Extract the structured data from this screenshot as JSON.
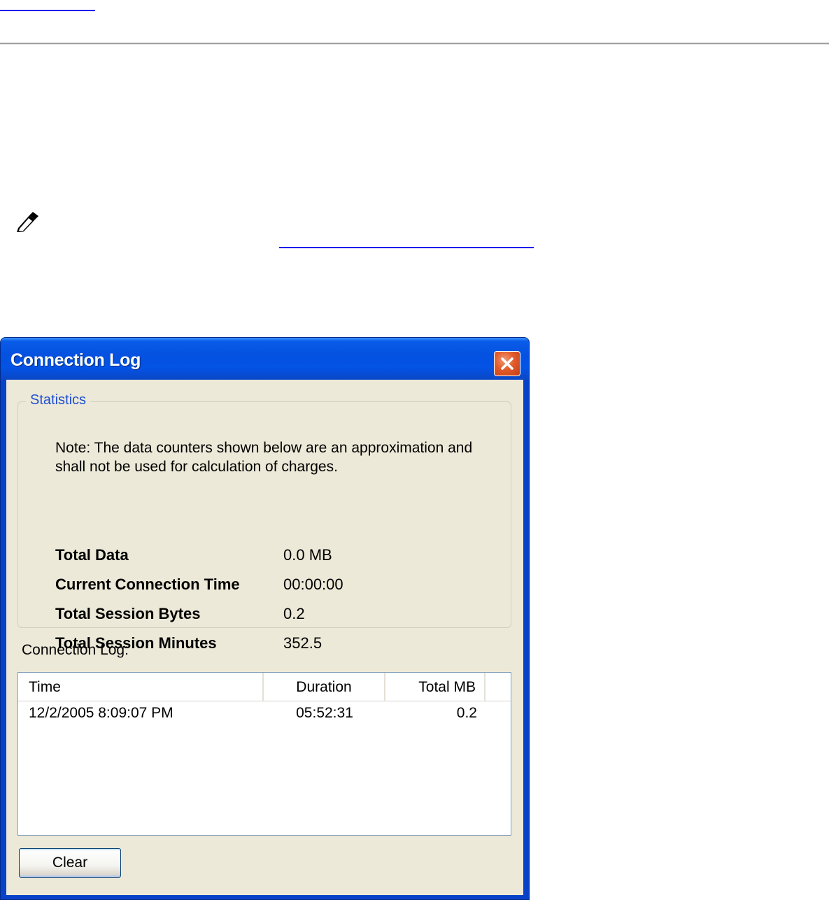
{
  "window": {
    "title": "Connection Log"
  },
  "statistics": {
    "legend": "Statistics",
    "note": "Note: The data counters shown below are an approximation and shall not be used for calculation of charges.",
    "rows": [
      {
        "label": "Total Data",
        "value": "0.0 MB"
      },
      {
        "label": "Current Connection Time",
        "value": "00:00:00"
      },
      {
        "label": "Total Session Bytes",
        "value": "0.2"
      },
      {
        "label": "Total Session Minutes",
        "value": "352.5"
      }
    ]
  },
  "log": {
    "label": "Connection Log:",
    "columns": [
      "Time",
      "Duration",
      "Total MB"
    ],
    "rows": [
      {
        "time": "12/2/2005 8:09:07 PM",
        "duration": "05:52:31",
        "total_mb": "0.2"
      }
    ]
  },
  "buttons": {
    "clear": "Clear"
  },
  "icons": {
    "close": "close-icon",
    "note": "note-pencil-icon"
  },
  "colors": {
    "titlebar": "#0551e0",
    "close_button": "#e25b2b",
    "dialog_face": "#ece9d8",
    "groupbox_legend": "#1f4fd0"
  }
}
